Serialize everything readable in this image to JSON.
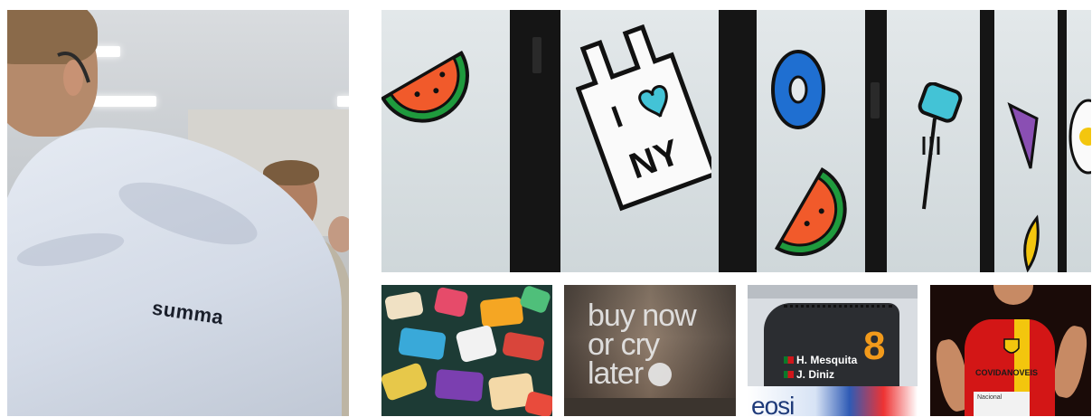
{
  "photos": {
    "presenter": {
      "shirt_logo": "summa"
    },
    "window_stickers": {
      "bag_sticker_text": "I NY"
    },
    "sticker_table": {},
    "shop_window": {
      "lines": [
        "buy now",
        "or cry",
        "later"
      ]
    },
    "rally_car": {
      "driver": "H. Mesquita",
      "codriver": "J. Diniz",
      "car_number": "8",
      "brand_partial": "eosi"
    },
    "runner": {
      "jersey_text": "COVIDANOVEIS",
      "bib_text": "Nacional"
    }
  },
  "colors": {
    "shirt": "#d4dbe7",
    "window_frame": "#151515",
    "watermelon_flesh": "#f15a2b",
    "watermelon_rind": "#1f9a3d",
    "donut": "#1f6fd1",
    "car_number": "#f29a1b",
    "jersey_red": "#d31616",
    "jersey_yellow": "#f3c60e"
  }
}
